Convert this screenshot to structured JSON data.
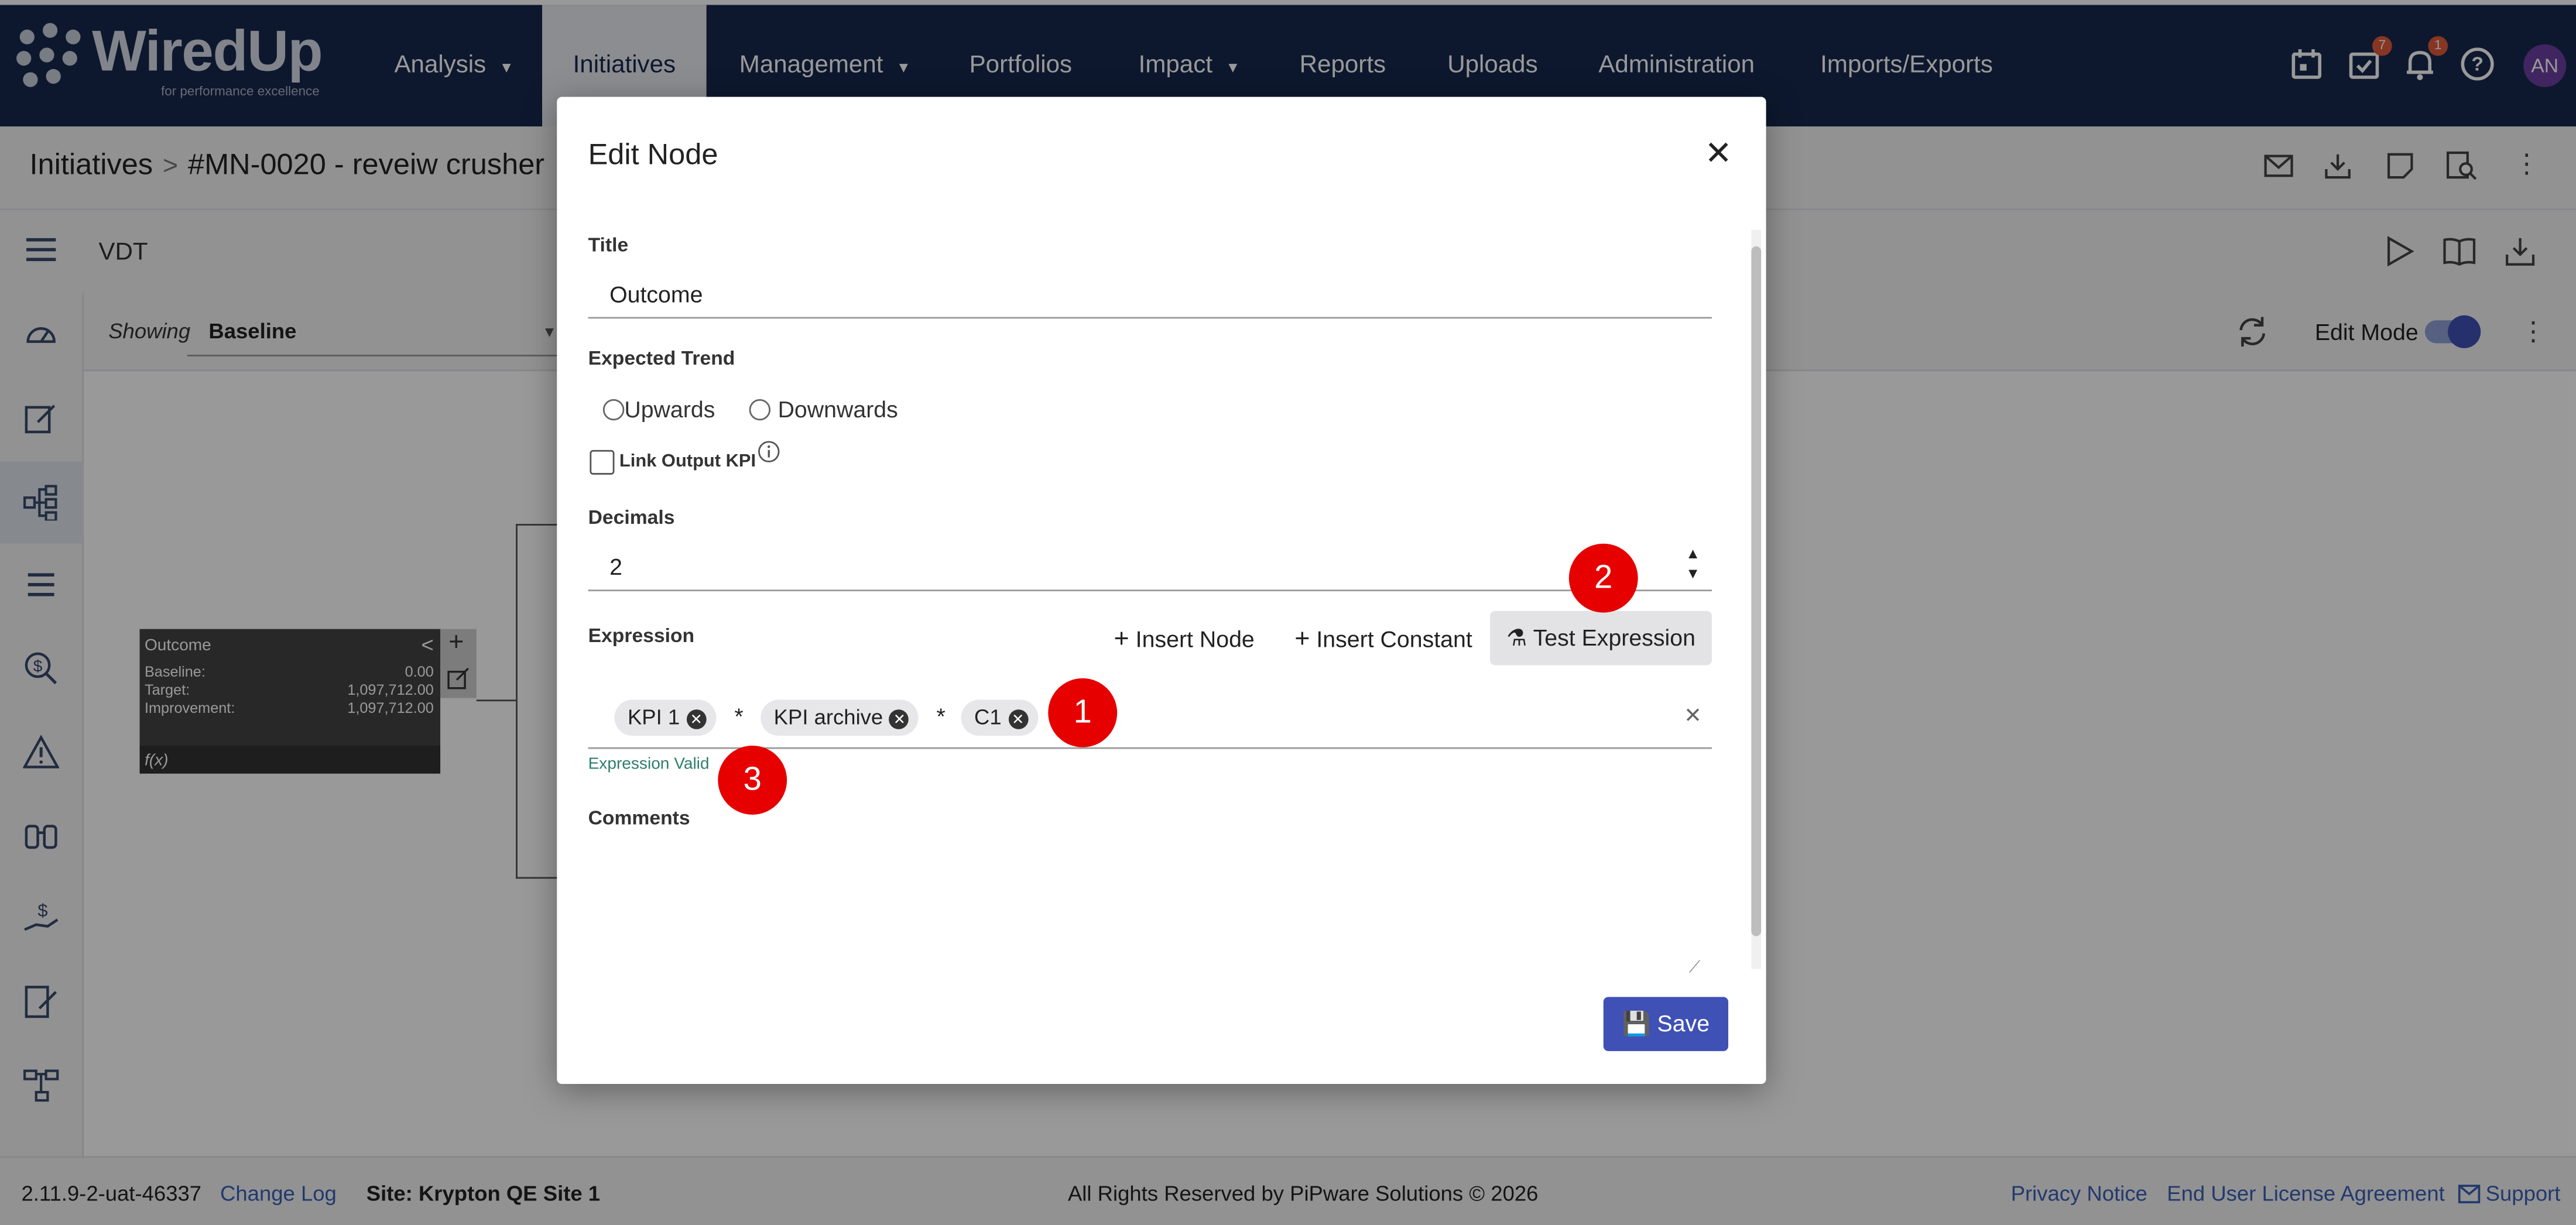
{
  "app": {
    "logo_text": "WiredUp",
    "logo_tagline": "for performance excellence"
  },
  "nav": {
    "items": [
      {
        "label": "Analysis",
        "caret": true
      },
      {
        "label": "Initiatives",
        "caret": false
      },
      {
        "label": "Management",
        "caret": true
      },
      {
        "label": "Portfolios",
        "caret": false
      },
      {
        "label": "Impact",
        "caret": true
      },
      {
        "label": "Reports",
        "caret": false
      },
      {
        "label": "Uploads",
        "caret": false
      },
      {
        "label": "Administration",
        "caret": false
      },
      {
        "label": "Imports/Exports",
        "caret": false
      }
    ],
    "active": "Initiatives",
    "tasks_badge": "7",
    "notifications_badge": "1",
    "avatar": "AN"
  },
  "breadcrumb": {
    "root": "Initiatives",
    "current": "#MN-0020 - reveiw crusher"
  },
  "page": {
    "section_title": "VDT"
  },
  "toolbar": {
    "showing_label": "Showing",
    "showing_value": "Baseline",
    "edit_mode_label": "Edit Mode"
  },
  "canvas_node": {
    "title": "Outcome",
    "rows": [
      {
        "label": "Baseline:",
        "value": "0.00"
      },
      {
        "label": "Target:",
        "value": "1,097,712.00"
      },
      {
        "label": "Improvement:",
        "value": "1,097,712.00"
      }
    ],
    "fx": "f(x)"
  },
  "modal": {
    "title": "Edit Node",
    "title_label": "Title",
    "title_value": "Outcome",
    "trend_label": "Expected Trend",
    "trend_options": [
      "Upwards",
      "Downwards"
    ],
    "link_output_label": "Link Output KPI",
    "decimals_label": "Decimals",
    "decimals_value": "2",
    "expression_label": "Expression",
    "insert_node": "Insert Node",
    "insert_constant": "Insert Constant",
    "test_expression": "Test Expression",
    "expression_chips": [
      "KPI 1",
      "KPI archive",
      "C1"
    ],
    "operator": "*",
    "expression_status": "Expression Valid",
    "comments_label": "Comments",
    "save": "Save"
  },
  "markers": [
    "1",
    "2",
    "3"
  ],
  "footer": {
    "version": "2.11.9-2-uat-46337",
    "change_log": "Change Log",
    "site": "Site: Krypton QE Site 1",
    "copyright": "All Rights Reserved by PiPware Solutions © 2026",
    "privacy": "Privacy Notice",
    "eula": "End User License Agreement",
    "support": "Support"
  },
  "colors": {
    "nav_bg": "#17294d",
    "accent": "#3f51b5",
    "marker": "#e60000",
    "valid": "#2e7d6b"
  }
}
